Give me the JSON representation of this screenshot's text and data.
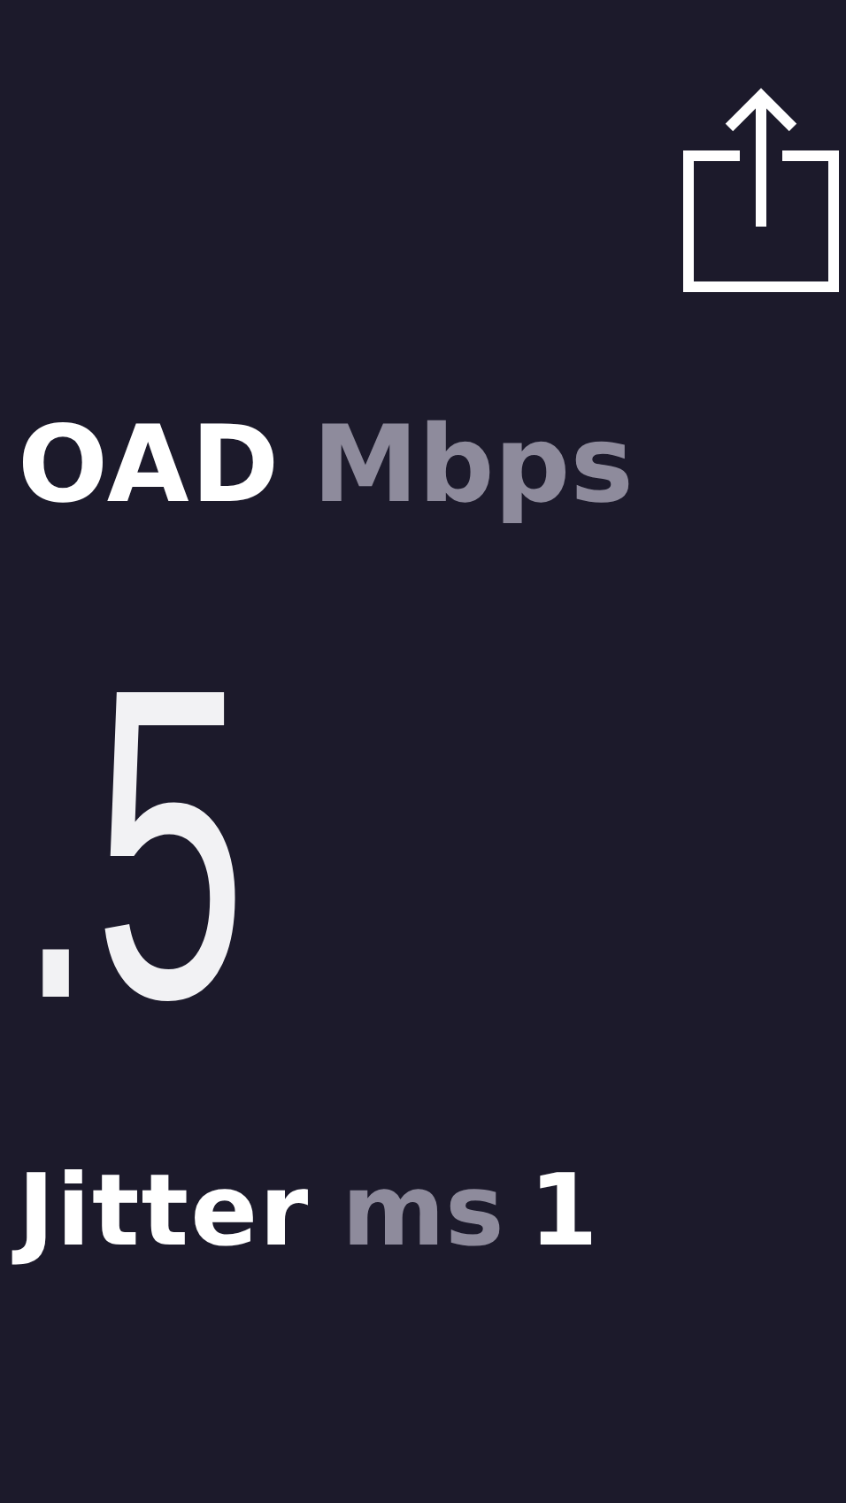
{
  "metric": {
    "label": "OAD",
    "unit": "Mbps",
    "value": ".5"
  },
  "jitter": {
    "label": "Jitter",
    "unit": "ms",
    "value": "1"
  }
}
